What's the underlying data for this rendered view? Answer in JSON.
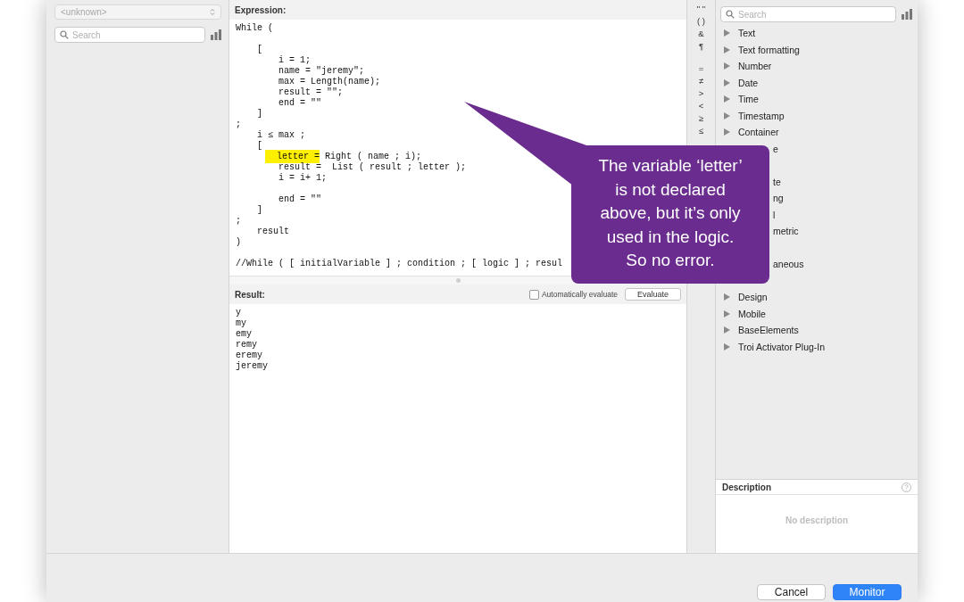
{
  "left_pane": {
    "table_select": {
      "value": "<unknown>",
      "disabled": true
    },
    "search": {
      "placeholder": "Search"
    }
  },
  "expression": {
    "heading": "Expression:",
    "lines": [
      {
        "kind": "code",
        "segments": [
          {
            "text": "While (",
            "highlighted": false
          }
        ]
      },
      {
        "kind": "blank"
      },
      {
        "kind": "code",
        "segments": [
          {
            "text": "    [",
            "highlighted": false
          }
        ]
      },
      {
        "kind": "code",
        "segments": [
          {
            "text": "        i = 1;",
            "highlighted": false
          }
        ]
      },
      {
        "kind": "code",
        "segments": [
          {
            "text": "        name = \"jeremy\";",
            "highlighted": false
          }
        ]
      },
      {
        "kind": "code",
        "segments": [
          {
            "text": "        max = Length(name);",
            "highlighted": false
          }
        ]
      },
      {
        "kind": "code",
        "segments": [
          {
            "text": "        result = \"\";",
            "highlighted": false
          }
        ]
      },
      {
        "kind": "code",
        "segments": [
          {
            "text": "        end = \"\"",
            "highlighted": false
          }
        ]
      },
      {
        "kind": "code",
        "segments": [
          {
            "text": "    ]",
            "highlighted": false
          }
        ]
      },
      {
        "kind": "code",
        "segments": [
          {
            "text": ";",
            "highlighted": false
          }
        ]
      },
      {
        "kind": "code",
        "segments": [
          {
            "text": "    i ≤ max ;",
            "highlighted": false
          }
        ]
      },
      {
        "kind": "code",
        "segments": [
          {
            "text": "    [",
            "highlighted": false
          }
        ]
      },
      {
        "kind": "code",
        "segments": [
          {
            "text": "letter =",
            "highlighted": true
          },
          {
            "text": " Right ( name ; i);",
            "highlighted": false
          }
        ]
      },
      {
        "kind": "code",
        "segments": [
          {
            "text": "        result =  List ( result ; letter );",
            "highlighted": false
          }
        ]
      },
      {
        "kind": "code",
        "segments": [
          {
            "text": "        i = i+ 1;",
            "highlighted": false
          }
        ]
      },
      {
        "kind": "blank"
      },
      {
        "kind": "code",
        "segments": [
          {
            "text": "        end = \"\"",
            "highlighted": false
          }
        ]
      },
      {
        "kind": "code",
        "segments": [
          {
            "text": "    ]",
            "highlighted": false
          }
        ]
      },
      {
        "kind": "code",
        "segments": [
          {
            "text": ";",
            "highlighted": false
          }
        ]
      },
      {
        "kind": "code",
        "segments": [
          {
            "text": "    result",
            "highlighted": false
          }
        ]
      },
      {
        "kind": "code",
        "segments": [
          {
            "text": ")",
            "highlighted": false
          }
        ]
      },
      {
        "kind": "blank"
      },
      {
        "kind": "code",
        "segments": [
          {
            "text": "//While ( [ initialVariable ] ; condition ; [ logic ] ; resul",
            "highlighted": false
          }
        ]
      }
    ]
  },
  "result": {
    "heading": "Result:",
    "auto_evaluate": {
      "label": "Automatically evaluate",
      "checked": false
    },
    "evaluate_button": "Evaluate",
    "lines": [
      "y",
      "my",
      "emy",
      "remy",
      "eremy",
      "jeremy"
    ]
  },
  "operators": [
    "\" \"",
    "( )",
    "&",
    "¶",
    "=",
    "≠",
    ">",
    "<",
    "≥",
    "≤"
  ],
  "functions": {
    "search": {
      "placeholder": "Search"
    },
    "categories": [
      {
        "label": "Text",
        "kind": "full"
      },
      {
        "label": "Text formatting",
        "kind": "full"
      },
      {
        "label": "Number",
        "kind": "full"
      },
      {
        "label": "Date",
        "kind": "full"
      },
      {
        "label": "Time",
        "kind": "full"
      },
      {
        "label": "Timestamp",
        "kind": "full"
      },
      {
        "label": "Container",
        "kind": "full"
      },
      {
        "label": "e",
        "kind": "partial"
      },
      {
        "kind": "covered"
      },
      {
        "label": "te",
        "kind": "partial"
      },
      {
        "label": "ng",
        "kind": "partial"
      },
      {
        "label": "l",
        "kind": "partial"
      },
      {
        "label": "metric",
        "kind": "partial"
      },
      {
        "kind": "covered"
      },
      {
        "label": "aneous",
        "kind": "partial"
      },
      {
        "kind": "covered"
      },
      {
        "label": "Design",
        "kind": "full"
      },
      {
        "label": "Mobile",
        "kind": "full"
      },
      {
        "label": "BaseElements",
        "kind": "full"
      },
      {
        "label": "Troi Activator Plug-In",
        "kind": "full"
      }
    ]
  },
  "description": {
    "heading": "Description",
    "text": "No description"
  },
  "buttons": [
    {
      "label": "Cancel",
      "primary": false
    },
    {
      "label": "Monitor",
      "primary": true
    }
  ],
  "callout": {
    "lines": [
      "The variable ‘letter’",
      "is not declared",
      "above, but it’s only",
      "used in the logic.",
      "So no error."
    ]
  }
}
